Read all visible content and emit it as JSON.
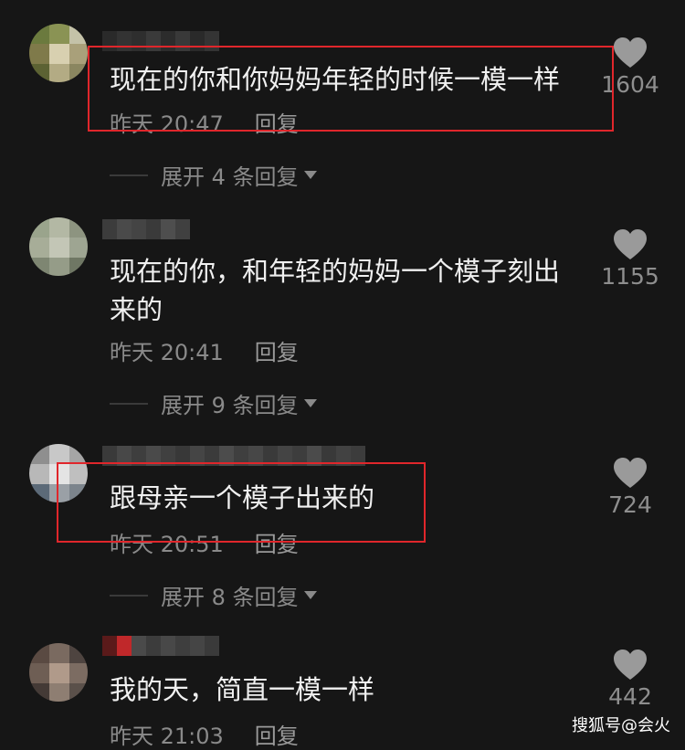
{
  "comments": [
    {
      "text": "现在的你和你妈妈年轻的时候一模一样",
      "time": "昨天 20:47",
      "reply_label": "回复",
      "expand_label": "展开 4 条回复",
      "likes": "1604",
      "highlighted": true
    },
    {
      "text": "现在的你，和年轻的妈妈一个模子刻出来的",
      "time": "昨天 20:41",
      "reply_label": "回复",
      "expand_label": "展开 9 条回复",
      "likes": "1155",
      "highlighted": false
    },
    {
      "text": "跟母亲一个模子出来的",
      "time": "昨天 20:51",
      "reply_label": "回复",
      "expand_label": "展开 8 条回复",
      "likes": "724",
      "highlighted": true
    },
    {
      "text": "我的天，简直一模一样",
      "time": "昨天 21:03",
      "reply_label": "回复",
      "likes": "442",
      "highlighted": false
    }
  ],
  "icons": {
    "like": "heart-icon",
    "expand": "caret-down-icon"
  },
  "colors": {
    "background": "#161616",
    "highlight_box": "#e0262b"
  },
  "watermark": "搜狐号@会火"
}
